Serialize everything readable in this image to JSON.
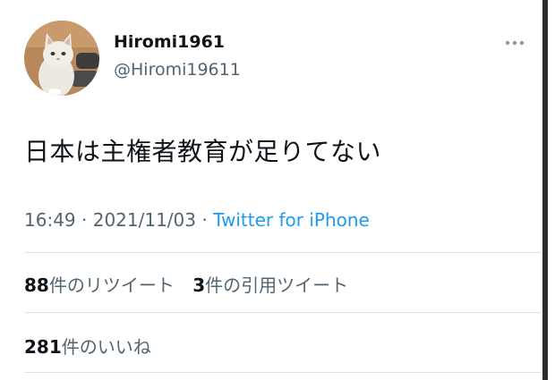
{
  "tweet": {
    "display_name": "Hiromi1961",
    "handle": "@Hiromi19611",
    "text": "日本は主権者教育が足りてない",
    "time": "16:49",
    "separator1": " · ",
    "date": "2021/11/03",
    "separator2": " · ",
    "source": "Twitter for iPhone"
  },
  "stats": {
    "retweets_count": "88",
    "retweets_label": "件のリツイート",
    "quotes_count": "3",
    "quotes_label": "件の引用ツイート",
    "likes_count": "281",
    "likes_label": "件のいいね"
  },
  "icons": {
    "more": "more-dots-icon",
    "avatar": "cat-photo-avatar"
  },
  "colors": {
    "text_primary": "#0f1419",
    "text_secondary": "#536471",
    "link": "#1d9bf0",
    "divider": "#dfe3e6"
  }
}
